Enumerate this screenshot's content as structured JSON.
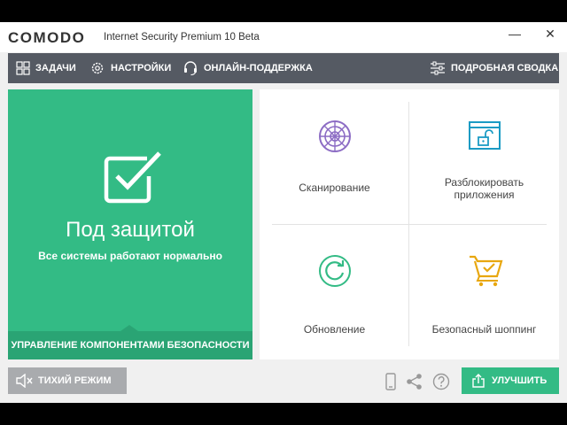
{
  "window": {
    "logo": "COMODO",
    "title": "Internet Security Premium 10 Beta",
    "minimize_glyph": "—",
    "close_glyph": "✕"
  },
  "toolbar": {
    "tasks": "ЗАДАЧИ",
    "settings": "НАСТРОЙКИ",
    "support": "ОНЛАЙН-ПОДДЕРЖКА",
    "summary": "ПОДРОБНАЯ СВОДКА"
  },
  "status": {
    "title": "Под защитой",
    "subtitle": "Все системы работают нормально",
    "footer": "УПРАВЛЕНИЕ КОМПОНЕНТАМИ БЕЗОПАСНОСТИ"
  },
  "tiles": {
    "scan": "Сканирование",
    "unblock_line1": "Разблокировать",
    "unblock_line2": "приложения",
    "update": "Обновление",
    "shopping": "Безопасный шоппинг"
  },
  "bottom": {
    "quiet_mode": "ТИХИЙ РЕЖИМ",
    "upgrade": "УЛУЧШИТЬ"
  },
  "colors": {
    "accent_green": "#33bb85",
    "toolbar_bg": "#555a63",
    "scan_icon": "#8c6cc4",
    "unblock_icon": "#1b9bc4",
    "update_icon": "#33bb85",
    "shopping_icon": "#e8a70f"
  },
  "icons": {
    "tasks": "grid-icon",
    "settings": "gear-icon",
    "support": "headset-icon",
    "summary": "sliders-icon",
    "status": "checkbox-icon",
    "scan": "radar-icon",
    "unblock": "unlocked-window-icon",
    "update": "refresh-icon",
    "shopping": "cart-icon",
    "quiet": "speaker-mute-icon",
    "mobile": "mobile-icon",
    "share": "share-icon",
    "help": "help-icon",
    "upgrade": "upload-icon"
  }
}
